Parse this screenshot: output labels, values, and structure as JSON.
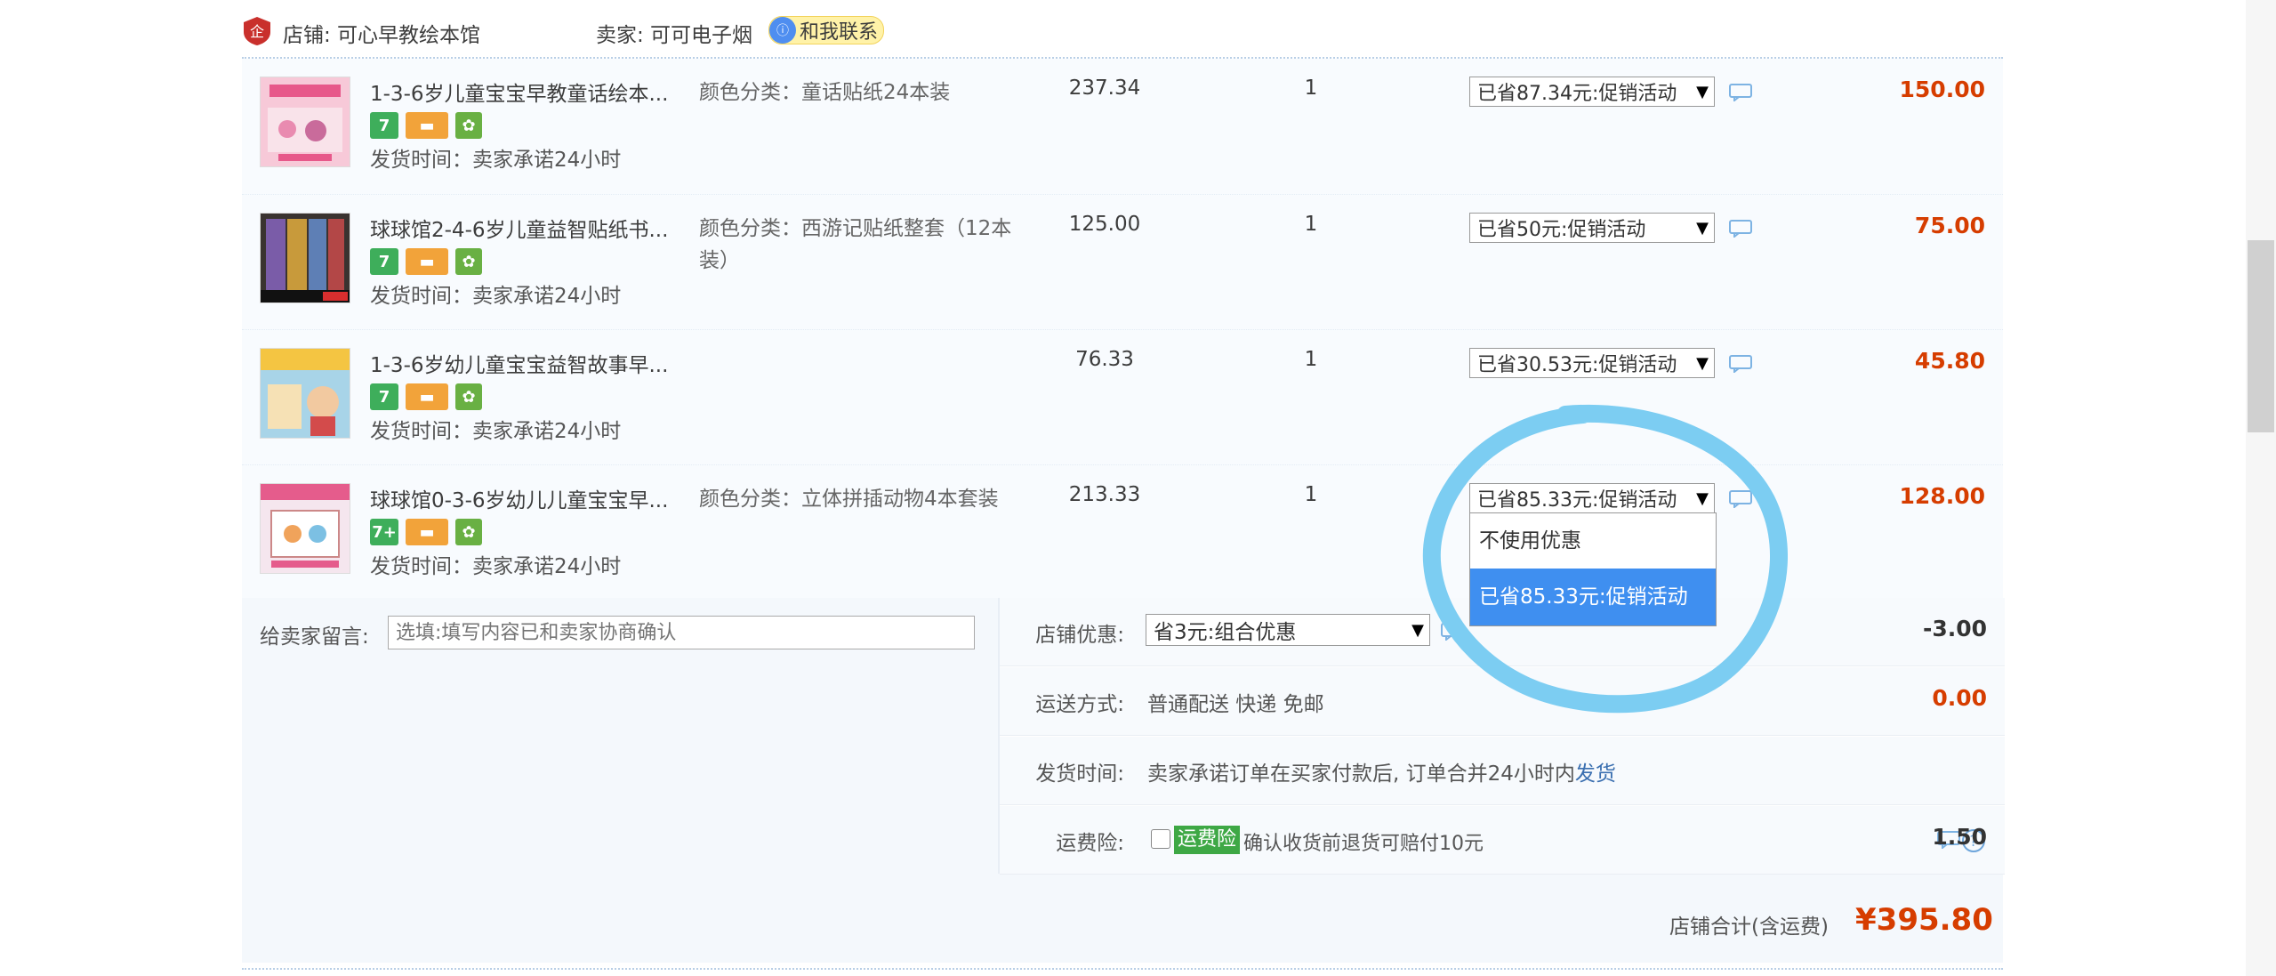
{
  "shop": {
    "label": "店铺: 可心早教绘本馆",
    "seller": "卖家: 可可电子烟",
    "contact": "和我联系"
  },
  "items": [
    {
      "title": "1-3-6岁儿童宝宝早教童话绘本...",
      "sku": "颜色分类：童话贴纸24本装",
      "price": "237.34",
      "qty": "1",
      "promo": "已省87.34元:促销活动",
      "total": "150.00",
      "ship": "发货时间：卖家承诺24小时",
      "badge7": "7"
    },
    {
      "title": "球球馆2-4-6岁儿童益智贴纸书...",
      "sku": "颜色分类：西游记贴纸整套（12本装）",
      "price": "125.00",
      "qty": "1",
      "promo": "已省50元:促销活动",
      "total": "75.00",
      "ship": "发货时间：卖家承诺24小时",
      "badge7": "7"
    },
    {
      "title": "1-3-6岁幼儿童宝宝益智故事早...",
      "sku": "",
      "price": "76.33",
      "qty": "1",
      "promo": "已省30.53元:促销活动",
      "total": "45.80",
      "ship": "发货时间：卖家承诺24小时",
      "badge7": "7"
    },
    {
      "title": "球球馆0-3-6岁幼儿儿童宝宝早...",
      "sku": "颜色分类：立体拼插动物4本套装",
      "price": "213.33",
      "qty": "1",
      "promo": "已省85.33元:促销活动",
      "total": "128.00",
      "ship": "发货时间：卖家承诺24小时",
      "badge7": "7+"
    }
  ],
  "dropdown": {
    "options": [
      "不使用优惠",
      "已省85.33元:促销活动"
    ],
    "selected_index": 1
  },
  "memo": {
    "label": "给卖家留言:",
    "placeholder": "选填:填写内容已和卖家协商确认"
  },
  "shop_discount": {
    "label": "店铺优惠:",
    "value": "省3元:组合优惠",
    "amount": "-3.00"
  },
  "delivery": {
    "label": "运送方式:",
    "value": "普通配送 快递 免邮",
    "amount": "0.00"
  },
  "ship_time": {
    "label": "发货时间:",
    "value": "卖家承诺订单在买家付款后, 订单合并24小时内",
    "link": "发货"
  },
  "insurance": {
    "label": "运费险:",
    "tag": "运费险",
    "desc": "确认收货前退货可赔付10元",
    "amount": "1.50",
    "help": "?"
  },
  "summary": {
    "label": "店铺合计(含运费)",
    "value": "¥395.80"
  },
  "colors": {
    "accent_red": "#d63d00",
    "highlight_blue": "#3f8ff0",
    "annotation_circle": "#7ccdf2"
  }
}
